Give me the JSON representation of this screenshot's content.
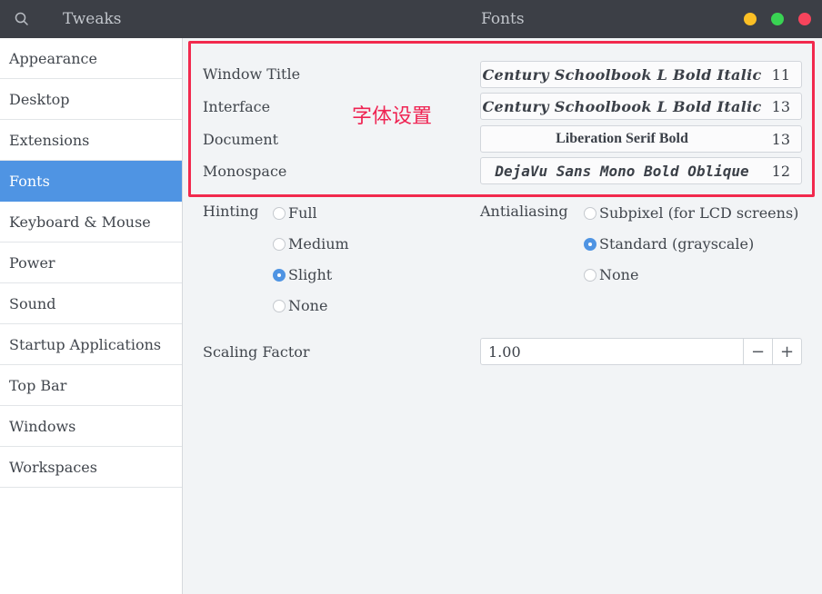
{
  "header": {
    "app_title": "Tweaks",
    "page_title": "Fonts",
    "search_icon": "search-icon",
    "window_buttons": {
      "minimize_color": "#fbbf25",
      "maximize_color": "#39d353",
      "close_color": "#f7445c"
    }
  },
  "sidebar": {
    "items": [
      {
        "label": "Appearance"
      },
      {
        "label": "Desktop"
      },
      {
        "label": "Extensions"
      },
      {
        "label": "Fonts",
        "active": true
      },
      {
        "label": "Keyboard & Mouse"
      },
      {
        "label": "Power"
      },
      {
        "label": "Sound"
      },
      {
        "label": "Startup Applications"
      },
      {
        "label": "Top Bar"
      },
      {
        "label": "Windows"
      },
      {
        "label": "Workspaces"
      }
    ],
    "active_color": "#4f94e3"
  },
  "fonts": {
    "window_title": {
      "label": "Window Title",
      "font": "Century Schoolbook L Bold Italic",
      "size": "11"
    },
    "interface": {
      "label": "Interface",
      "font": "Century Schoolbook L Bold Italic",
      "size": "13"
    },
    "document": {
      "label": "Document",
      "font": "Liberation Serif Bold",
      "size": "13"
    },
    "monospace": {
      "label": "Monospace",
      "font": "DejaVu Sans Mono Bold Oblique",
      "size": "12"
    }
  },
  "annotation": {
    "text": "字体设置",
    "color": "#f2294d"
  },
  "hinting": {
    "label": "Hinting",
    "options": [
      "Full",
      "Medium",
      "Slight",
      "None"
    ],
    "selected": "Slight"
  },
  "antialiasing": {
    "label": "Antialiasing",
    "options": [
      "Subpixel (for LCD screens)",
      "Standard (grayscale)",
      "None"
    ],
    "selected": "Standard (grayscale)"
  },
  "scaling": {
    "label": "Scaling Factor",
    "value": "1.00",
    "minus": "−",
    "plus": "+"
  }
}
